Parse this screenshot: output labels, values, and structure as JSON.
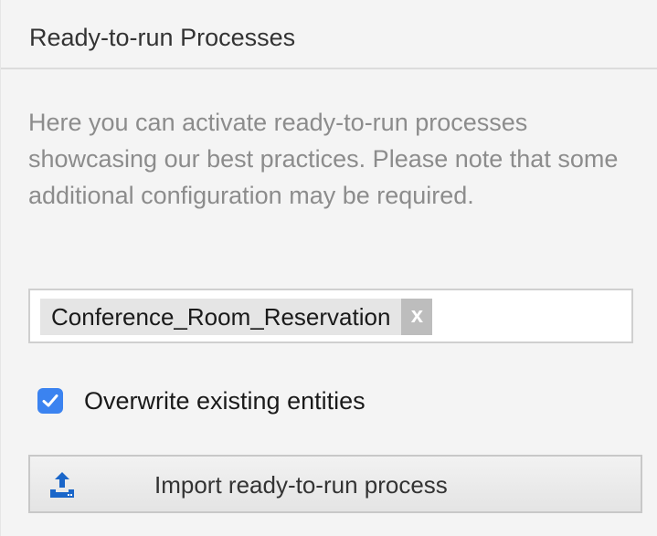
{
  "panel": {
    "title": "Ready-to-run Processes",
    "description": "Here you can activate ready-to-run processes showcasing our best practices. Please note that some additional configuration may be required."
  },
  "process_select": {
    "selected_tags": [
      {
        "label": "Conference_Room_Reservation",
        "remove_label": "x"
      }
    ]
  },
  "overwrite": {
    "label": "Overwrite existing entities",
    "checked": true
  },
  "import_button": {
    "label": "Import ready-to-run process",
    "icon": "upload-icon"
  },
  "colors": {
    "accent": "#3b83f0",
    "title": "#333333",
    "description": "#8c8c8c",
    "panel_bg": "#f4f4f4"
  }
}
